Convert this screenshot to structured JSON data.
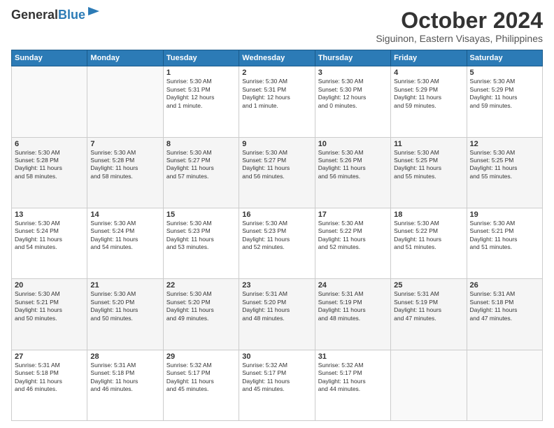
{
  "header": {
    "logo_general": "General",
    "logo_blue": "Blue",
    "month_title": "October 2024",
    "location": "Siguinon, Eastern Visayas, Philippines"
  },
  "days_of_week": [
    "Sunday",
    "Monday",
    "Tuesday",
    "Wednesday",
    "Thursday",
    "Friday",
    "Saturday"
  ],
  "weeks": [
    [
      {
        "day": "",
        "text": ""
      },
      {
        "day": "",
        "text": ""
      },
      {
        "day": "1",
        "text": "Sunrise: 5:30 AM\nSunset: 5:31 PM\nDaylight: 12 hours\nand 1 minute."
      },
      {
        "day": "2",
        "text": "Sunrise: 5:30 AM\nSunset: 5:31 PM\nDaylight: 12 hours\nand 1 minute."
      },
      {
        "day": "3",
        "text": "Sunrise: 5:30 AM\nSunset: 5:30 PM\nDaylight: 12 hours\nand 0 minutes."
      },
      {
        "day": "4",
        "text": "Sunrise: 5:30 AM\nSunset: 5:29 PM\nDaylight: 11 hours\nand 59 minutes."
      },
      {
        "day": "5",
        "text": "Sunrise: 5:30 AM\nSunset: 5:29 PM\nDaylight: 11 hours\nand 59 minutes."
      }
    ],
    [
      {
        "day": "6",
        "text": "Sunrise: 5:30 AM\nSunset: 5:28 PM\nDaylight: 11 hours\nand 58 minutes."
      },
      {
        "day": "7",
        "text": "Sunrise: 5:30 AM\nSunset: 5:28 PM\nDaylight: 11 hours\nand 58 minutes."
      },
      {
        "day": "8",
        "text": "Sunrise: 5:30 AM\nSunset: 5:27 PM\nDaylight: 11 hours\nand 57 minutes."
      },
      {
        "day": "9",
        "text": "Sunrise: 5:30 AM\nSunset: 5:27 PM\nDaylight: 11 hours\nand 56 minutes."
      },
      {
        "day": "10",
        "text": "Sunrise: 5:30 AM\nSunset: 5:26 PM\nDaylight: 11 hours\nand 56 minutes."
      },
      {
        "day": "11",
        "text": "Sunrise: 5:30 AM\nSunset: 5:25 PM\nDaylight: 11 hours\nand 55 minutes."
      },
      {
        "day": "12",
        "text": "Sunrise: 5:30 AM\nSunset: 5:25 PM\nDaylight: 11 hours\nand 55 minutes."
      }
    ],
    [
      {
        "day": "13",
        "text": "Sunrise: 5:30 AM\nSunset: 5:24 PM\nDaylight: 11 hours\nand 54 minutes."
      },
      {
        "day": "14",
        "text": "Sunrise: 5:30 AM\nSunset: 5:24 PM\nDaylight: 11 hours\nand 54 minutes."
      },
      {
        "day": "15",
        "text": "Sunrise: 5:30 AM\nSunset: 5:23 PM\nDaylight: 11 hours\nand 53 minutes."
      },
      {
        "day": "16",
        "text": "Sunrise: 5:30 AM\nSunset: 5:23 PM\nDaylight: 11 hours\nand 52 minutes."
      },
      {
        "day": "17",
        "text": "Sunrise: 5:30 AM\nSunset: 5:22 PM\nDaylight: 11 hours\nand 52 minutes."
      },
      {
        "day": "18",
        "text": "Sunrise: 5:30 AM\nSunset: 5:22 PM\nDaylight: 11 hours\nand 51 minutes."
      },
      {
        "day": "19",
        "text": "Sunrise: 5:30 AM\nSunset: 5:21 PM\nDaylight: 11 hours\nand 51 minutes."
      }
    ],
    [
      {
        "day": "20",
        "text": "Sunrise: 5:30 AM\nSunset: 5:21 PM\nDaylight: 11 hours\nand 50 minutes."
      },
      {
        "day": "21",
        "text": "Sunrise: 5:30 AM\nSunset: 5:20 PM\nDaylight: 11 hours\nand 50 minutes."
      },
      {
        "day": "22",
        "text": "Sunrise: 5:30 AM\nSunset: 5:20 PM\nDaylight: 11 hours\nand 49 minutes."
      },
      {
        "day": "23",
        "text": "Sunrise: 5:31 AM\nSunset: 5:20 PM\nDaylight: 11 hours\nand 48 minutes."
      },
      {
        "day": "24",
        "text": "Sunrise: 5:31 AM\nSunset: 5:19 PM\nDaylight: 11 hours\nand 48 minutes."
      },
      {
        "day": "25",
        "text": "Sunrise: 5:31 AM\nSunset: 5:19 PM\nDaylight: 11 hours\nand 47 minutes."
      },
      {
        "day": "26",
        "text": "Sunrise: 5:31 AM\nSunset: 5:18 PM\nDaylight: 11 hours\nand 47 minutes."
      }
    ],
    [
      {
        "day": "27",
        "text": "Sunrise: 5:31 AM\nSunset: 5:18 PM\nDaylight: 11 hours\nand 46 minutes."
      },
      {
        "day": "28",
        "text": "Sunrise: 5:31 AM\nSunset: 5:18 PM\nDaylight: 11 hours\nand 46 minutes."
      },
      {
        "day": "29",
        "text": "Sunrise: 5:32 AM\nSunset: 5:17 PM\nDaylight: 11 hours\nand 45 minutes."
      },
      {
        "day": "30",
        "text": "Sunrise: 5:32 AM\nSunset: 5:17 PM\nDaylight: 11 hours\nand 45 minutes."
      },
      {
        "day": "31",
        "text": "Sunrise: 5:32 AM\nSunset: 5:17 PM\nDaylight: 11 hours\nand 44 minutes."
      },
      {
        "day": "",
        "text": ""
      },
      {
        "day": "",
        "text": ""
      }
    ]
  ]
}
